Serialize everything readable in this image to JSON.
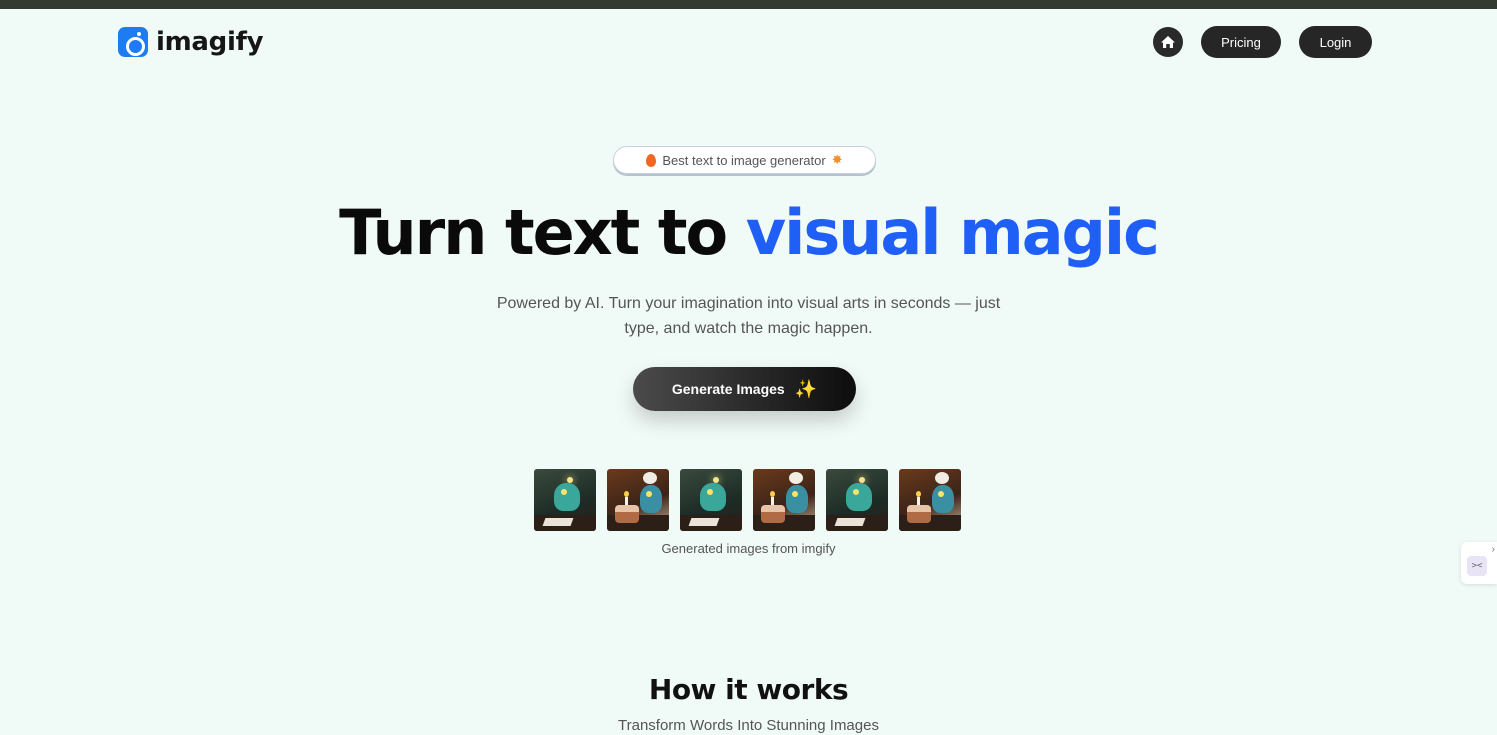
{
  "header": {
    "brand": "imagify",
    "nav": {
      "home_icon": "home-icon",
      "pricing_label": "Pricing",
      "login_label": "Login"
    }
  },
  "hero": {
    "badge_text": "Best text to image generator",
    "headline_plain": "Turn text to ",
    "headline_accent": "visual magic",
    "subtitle_line1": "Powered by AI. Turn your imagination into visual arts in seconds — just",
    "subtitle_line2": "type, and watch the magic happen.",
    "cta_label": "Generate Images",
    "gallery_caption": "Generated images from imgify"
  },
  "how_it_works": {
    "title": "How it works",
    "subtitle": "Transform Words Into Stunning Images"
  },
  "colors": {
    "accent": "#1f5ff5",
    "background": "#f0faf6",
    "logo": "#1e7cf2",
    "button": "#262626"
  }
}
